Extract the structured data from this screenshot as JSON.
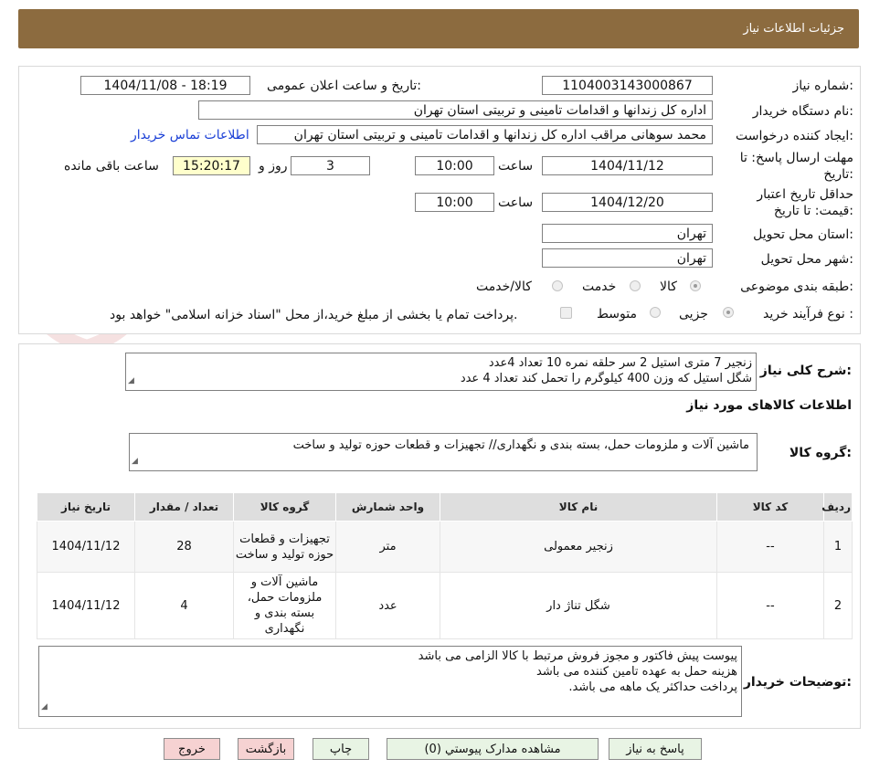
{
  "header": {
    "title": "جزئیات اطلاعات نیاز"
  },
  "form": {
    "need_number": {
      "label": "شماره نیاز:",
      "value": "1104003143000867"
    },
    "announce_datetime": {
      "label": "تاریخ و ساعت اعلان عمومی:",
      "value": "1404/11/08 - 18:19"
    },
    "buyer_org": {
      "label": "نام دستگاه خریدار:",
      "value": "اداره کل زندانها و اقدامات تامینی و تربیتی استان تهران"
    },
    "requester": {
      "label": "ایجاد کننده درخواست:",
      "value": "محمد سوهانی مراقب  اداره کل زندانها و اقدامات تامینی و تربیتی استان تهران"
    },
    "contact_link": "اطلاعات تماس خریدار",
    "deadline": {
      "label_line1": "مهلت ارسال پاسخ: تا",
      "label_line2": "تاریخ:",
      "date": "1404/11/12",
      "time_label": "ساعت",
      "time": "10:00",
      "days": "3",
      "days_label": "روز و",
      "remaining": "15:20:17",
      "remaining_label": "ساعت باقی مانده"
    },
    "price_validity": {
      "label_line1": "حداقل تاریخ اعتبار",
      "label_line2": "قیمت: تا تاریخ:",
      "date": "1404/12/20",
      "time_label": "ساعت",
      "time": "10:00"
    },
    "delivery_province": {
      "label": "استان محل تحویل:",
      "value": "تهران"
    },
    "delivery_city": {
      "label": "شهر محل تحویل:",
      "value": "تهران"
    },
    "category": {
      "label": "طبقه بندی موضوعی:",
      "options": [
        "کالا",
        "خدمت",
        "کالا/خدمت"
      ],
      "selected": "کالا"
    },
    "purchase_process": {
      "label": "نوع فرآیند خرید :",
      "options": [
        "جزیی",
        "متوسط"
      ],
      "selected": "جزیی",
      "payment_note": "پرداخت تمام یا بخشی از مبلغ خرید،از محل \"اسناد خزانه اسلامی\" خواهد بود."
    }
  },
  "summary": {
    "label": "شرح کلی نیاز:",
    "lines": [
      "زنجیر 7 متری استیل 2 سر حلقه نمره 10 تعداد 4عدد",
      "شگل استیل که وزن 400 کیلوگرم را تحمل کند تعداد 4 عدد"
    ]
  },
  "items_section": {
    "title": "اطلاعات کالاهای مورد نیاز",
    "group_label": "گروه کالا:",
    "group_value": "ماشین آلات و ملزومات حمل، بسته بندی و نگهداری// تجهیزات و قطعات حوزه تولید و ساخت"
  },
  "table": {
    "headers": [
      "ردیف",
      "کد کالا",
      "نام کالا",
      "واحد شمارش",
      "گروه کالا",
      "تعداد / مقدار",
      "تاریخ نیاز"
    ],
    "rows": [
      {
        "row": "1",
        "code": "--",
        "name": "زنجیر معمولی",
        "unit": "متر",
        "group": "تجهیزات و قطعات حوزه تولید و ساخت",
        "qty": "28",
        "date": "1404/11/12"
      },
      {
        "row": "2",
        "code": "--",
        "name": "شگل تناژ دار",
        "unit": "عدد",
        "group": "ماشین آلات و ملزومات حمل، بسته بندی و نگهداری",
        "qty": "4",
        "date": "1404/11/12"
      }
    ]
  },
  "buyer_notes": {
    "label": "توضیحات خریدار:",
    "lines": [
      "پیوست پیش فاکتور و مجوز فروش مرتبط با کالا الزامی می باشد",
      "هزینه حمل به عهده تامین کننده می باشد",
      "پرداخت حداکثر یک ماهه می باشد."
    ]
  },
  "buttons": {
    "reply": "پاسخ به نیاز",
    "attachments": "مشاهده مدارک پیوستي (0)",
    "print": "چاپ",
    "back": "بازگشت",
    "exit": "خروج"
  },
  "watermark": "AriaTender.neT",
  "colors": {
    "header": "#8c6b3f",
    "link": "#1a3fd6",
    "button_green": "#e8f4e4",
    "button_pink": "#f6d2d2"
  }
}
